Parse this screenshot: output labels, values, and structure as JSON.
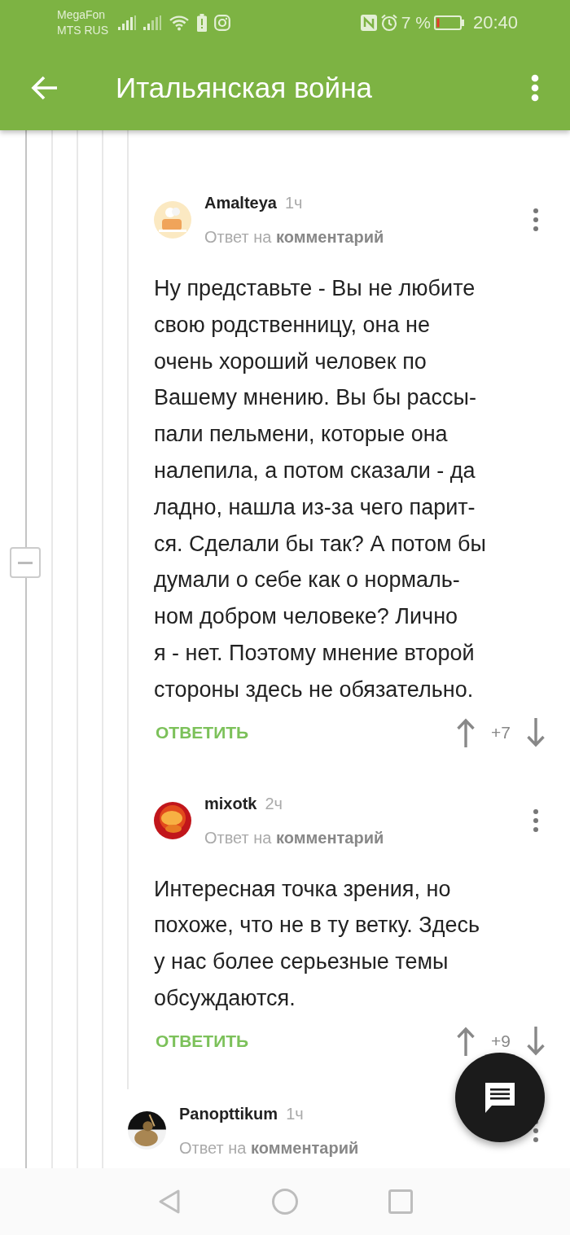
{
  "status_bar": {
    "carriers": [
      "MegaFon",
      "MTS RUS"
    ],
    "battery_percent": "7 %",
    "time": "20:40"
  },
  "app_bar": {
    "title": "Итальянская война"
  },
  "nested_replies": [
    {
      "author": "Amalteya",
      "time": "1ч",
      "reply_prefix": "Ответ на",
      "reply_link": "комментарий",
      "body": "Ну представьте - Вы не любите\nсвою родственницу, она не\nочень хороший человек по\nВашему мнению. Вы бы рассы-\nпали пельмени, которые она\nналепила, а потом сказали - да\nладно, нашла из-за чего парит-\nся. Сделали бы так? А потом бы\nдумали о себе как о нормаль-\nном добром человеке? Лично\nя - нет. Поэтому мнение второй\nстороны здесь не обязательно.",
      "reply_label": "ОТВЕТИТЬ",
      "score": "+7"
    },
    {
      "author": "mixotk",
      "time": "2ч",
      "reply_prefix": "Ответ на",
      "reply_link": "комментарий",
      "body": "Интересная точка зрения, но\nпохоже, что не в ту ветку. Здесь\nу нас более серьезные темы\nобсуждаются.",
      "reply_label": "ОТВЕТИТЬ",
      "score": "+9"
    }
  ],
  "comments": [
    {
      "author": "Panopttikum",
      "time": "1ч",
      "reply_prefix": "Ответ на",
      "reply_link": "комментарий"
    }
  ]
}
